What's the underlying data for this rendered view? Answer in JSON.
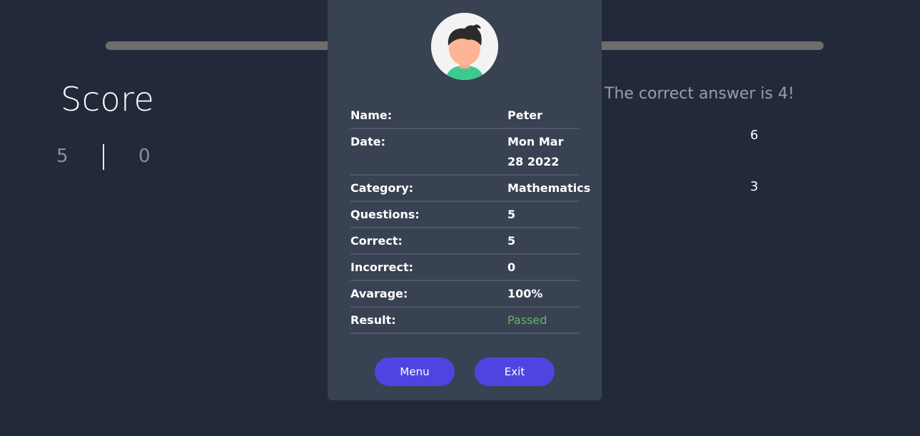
{
  "progress": {
    "fraction": 1.0
  },
  "score": {
    "title": "Score",
    "correct": "5",
    "incorrect": "0"
  },
  "question": {
    "feedback": "ter! The correct answer is 4!",
    "options": [
      "6",
      "3"
    ]
  },
  "results": {
    "avatar_icon": "user-avatar-icon",
    "rows": [
      {
        "label": "Name:",
        "value": "Peter"
      },
      {
        "label": "Date:",
        "value": "Mon Mar 28 2022"
      },
      {
        "label": "Category:",
        "value": "Mathematics"
      },
      {
        "label": "Questions:",
        "value": "5"
      },
      {
        "label": "Correct:",
        "value": "5"
      },
      {
        "label": "Incorrect:",
        "value": "0"
      },
      {
        "label": "Avarage:",
        "value": "100%"
      },
      {
        "label": "Result:",
        "value": "Passed"
      }
    ],
    "menu_label": "Menu",
    "exit_label": "Exit"
  },
  "colors": {
    "background": "#222a3a",
    "modal": "#394253",
    "accent": "#5044e0",
    "passed": "#5cb85c"
  }
}
